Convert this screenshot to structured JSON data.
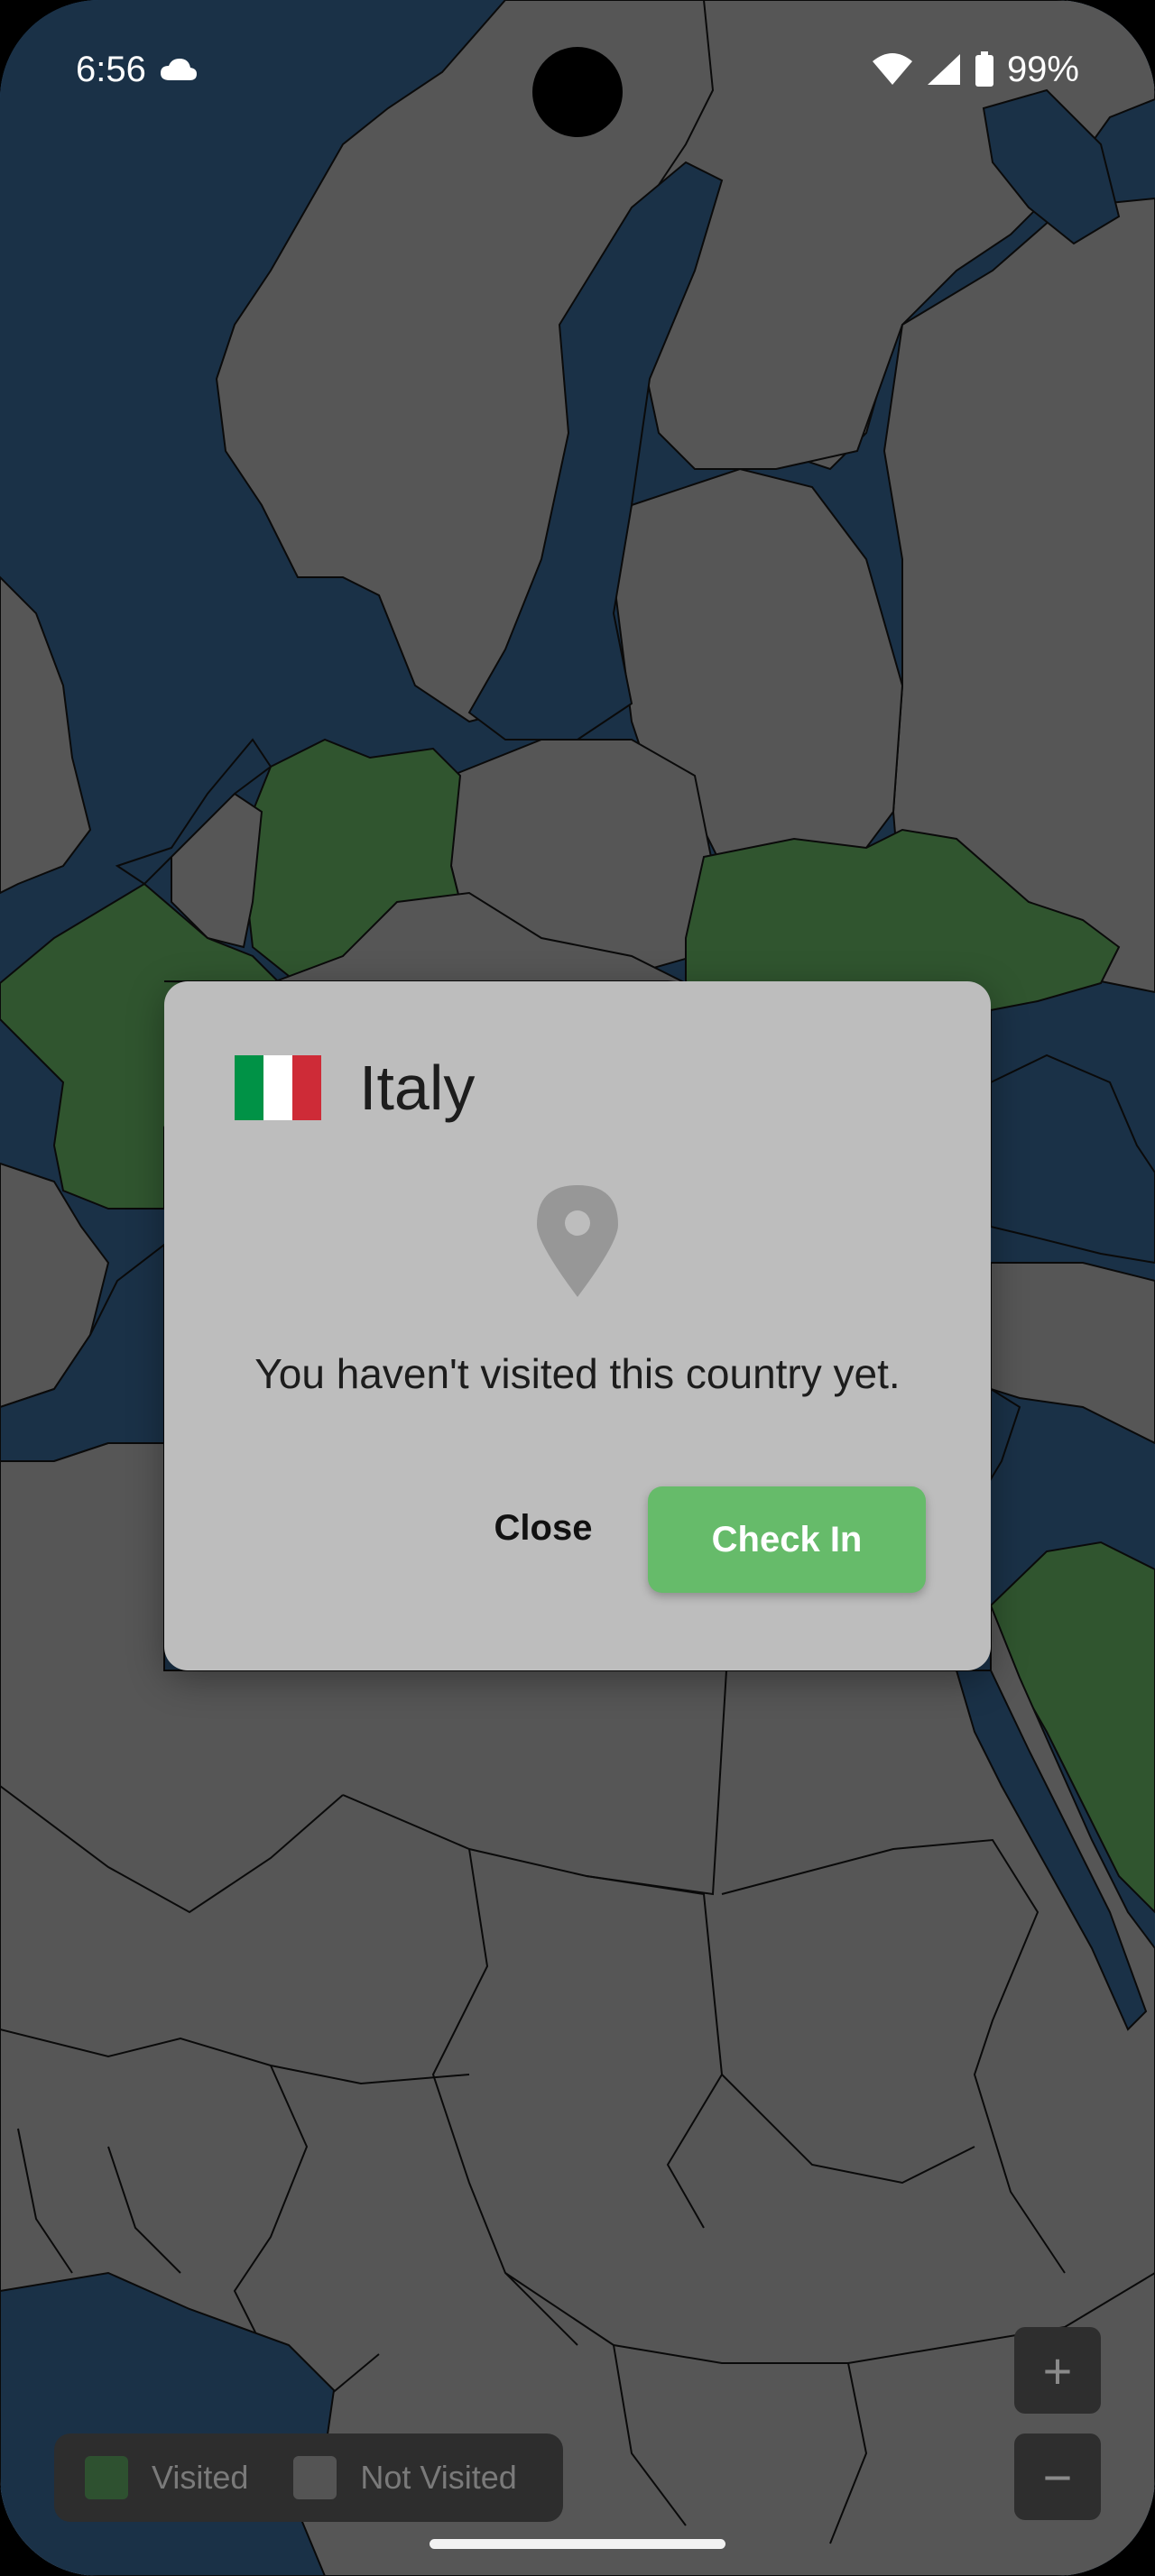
{
  "status_bar": {
    "time": "6:56",
    "battery": "99%",
    "icons": [
      "cloud-icon",
      "wifi-icon",
      "signal-icon",
      "battery-icon"
    ]
  },
  "map": {
    "colors": {
      "water": "#2a4f73",
      "land": "#8c8c8c",
      "visited": "#4e8a4c",
      "border": "#111111"
    }
  },
  "dialog": {
    "country": "Italy",
    "flag_colors": [
      "#009246",
      "#ffffff",
      "#ce2b37"
    ],
    "message": "You haven't visited this country yet.",
    "close_label": "Close",
    "checkin_label": "Check In",
    "checkin_color": "#66bb6a"
  },
  "legend": {
    "visited_label": "Visited",
    "not_visited_label": "Not Visited"
  },
  "zoom": {
    "in_label": "+",
    "out_label": "−"
  }
}
